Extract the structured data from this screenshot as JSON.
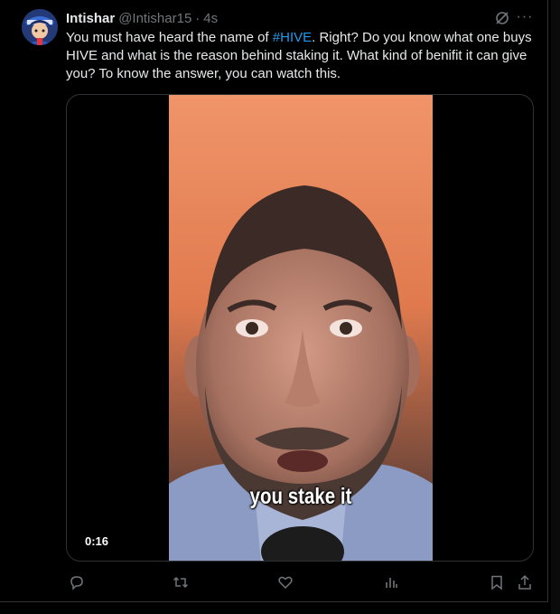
{
  "tweet": {
    "author_name": "Intishar",
    "author_handle": "@Intishar15",
    "separator": "·",
    "timestamp": "4s",
    "text_before": "You must have heard the name of ",
    "hashtag": "#HIVE",
    "text_after": ". Right? Do you know what one buys HIVE and what is the reason behind staking it. What kind of benifit it can give you? To know the answer, you can watch this.",
    "more_glyph": "···"
  },
  "media": {
    "caption": "you stake it",
    "duration": "0:16"
  },
  "colors": {
    "background": "#000000",
    "text": "#e7e9ea",
    "muted": "#71767b",
    "link": "#1d9bf0",
    "border": "#2f3336"
  },
  "icons": [
    "grok-icon",
    "more-icon",
    "reply-icon",
    "retweet-icon",
    "like-icon",
    "views-icon",
    "bookmark-icon",
    "share-icon"
  ]
}
